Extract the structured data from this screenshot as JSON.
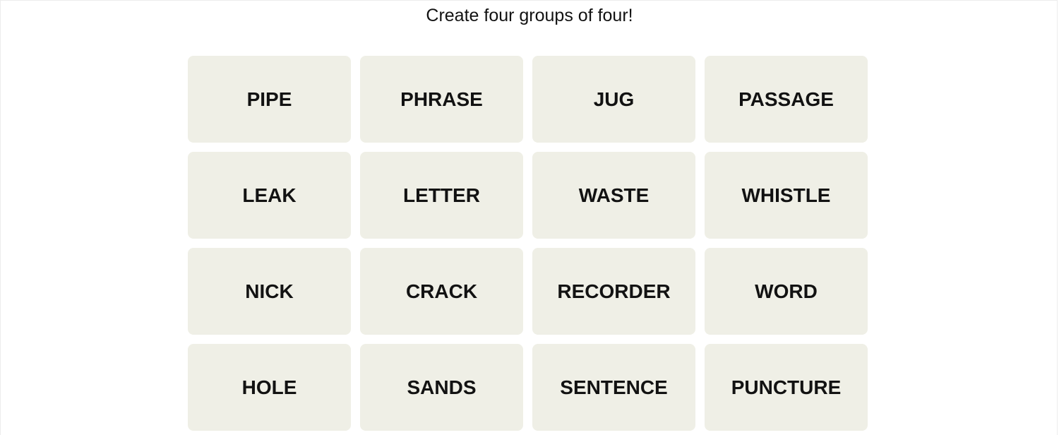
{
  "header": {
    "instructions": "Create four groups of four!"
  },
  "board": {
    "tiles": [
      {
        "label": "PIPE"
      },
      {
        "label": "PHRASE"
      },
      {
        "label": "JUG"
      },
      {
        "label": "PASSAGE"
      },
      {
        "label": "LEAK"
      },
      {
        "label": "LETTER"
      },
      {
        "label": "WASTE"
      },
      {
        "label": "WHISTLE"
      },
      {
        "label": "NICK"
      },
      {
        "label": "CRACK"
      },
      {
        "label": "RECORDER"
      },
      {
        "label": "WORD"
      },
      {
        "label": "HOLE"
      },
      {
        "label": "SANDS"
      },
      {
        "label": "SENTENCE"
      },
      {
        "label": "PUNCTURE"
      }
    ]
  },
  "colors": {
    "tile_background": "#efefe6",
    "tile_text": "#121212",
    "page_background": "#ffffff"
  }
}
